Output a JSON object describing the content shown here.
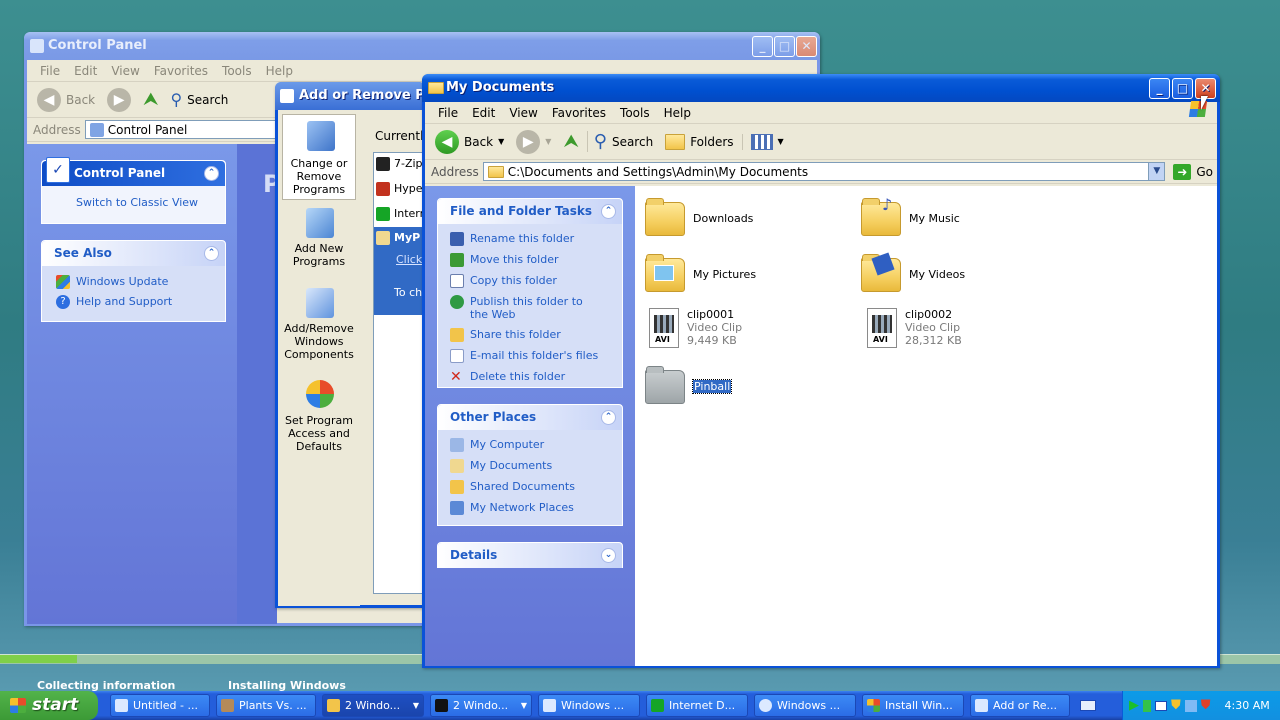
{
  "control_panel": {
    "title": "Control Panel",
    "menu": [
      "File",
      "Edit",
      "View",
      "Favorites",
      "Tools",
      "Help"
    ],
    "toolbar": {
      "back": "Back",
      "search": "Search"
    },
    "address_label": "Address",
    "address_value": "Control Panel",
    "side_title": "Control Panel",
    "switch_view": "Switch to Classic View",
    "see_also_title": "See Also",
    "see_also": [
      "Windows Update",
      "Help and Support"
    ],
    "main_initial": "P"
  },
  "add_remove": {
    "title": "Add or Remove Programs",
    "nav": [
      {
        "label": "Change or Remove Programs"
      },
      {
        "label": "Add New Programs"
      },
      {
        "label": "Add/Remove Windows Components"
      },
      {
        "label": "Set Program Access and Defaults"
      }
    ],
    "currently": "Currently",
    "programs": [
      "7-Zip",
      "Hype",
      "Intern",
      "MyP"
    ],
    "selected_link": "Click",
    "selected_text": "To ch"
  },
  "my_documents": {
    "title": "My Documents",
    "menu": [
      "File",
      "Edit",
      "View",
      "Favorites",
      "Tools",
      "Help"
    ],
    "toolbar": {
      "back": "Back",
      "search": "Search",
      "folders": "Folders"
    },
    "address_label": "Address",
    "address_value": "C:\\Documents and Settings\\Admin\\My Documents",
    "go_label": "Go",
    "tasks_title": "File and Folder Tasks",
    "tasks": [
      "Rename this folder",
      "Move this folder",
      "Copy this folder",
      "Publish this folder to the Web",
      "Share this folder",
      "E-mail this folder's files",
      "Delete this folder"
    ],
    "other_title": "Other Places",
    "other": [
      "My Computer",
      "My Documents",
      "Shared Documents",
      "My Network Places"
    ],
    "details_title": "Details",
    "items": [
      {
        "name": "Downloads"
      },
      {
        "name": "My Music"
      },
      {
        "name": "My Pictures"
      },
      {
        "name": "My Videos"
      },
      {
        "name": "clip0001",
        "type": "Video Clip",
        "size": "9,449 KB"
      },
      {
        "name": "clip0002",
        "type": "Video Clip",
        "size": "28,312 KB"
      },
      {
        "name": "Pinball"
      }
    ]
  },
  "background": {
    "status_left": "Collecting information",
    "status_right": "Installing Windows",
    "progress": 0.06
  },
  "taskbar": {
    "start": "start",
    "tasks": [
      "Untitled - ...",
      "Plants Vs. ...",
      "2 Windo...",
      "2 Windo...",
      "Windows ...",
      "Internet D...",
      "Windows ...",
      "Install Win...",
      "Add or Re..."
    ],
    "clock": "4:30 AM"
  },
  "colors": {
    "accent": "#0a52d8",
    "panel": "#6375d6",
    "link": "#215dc6"
  }
}
